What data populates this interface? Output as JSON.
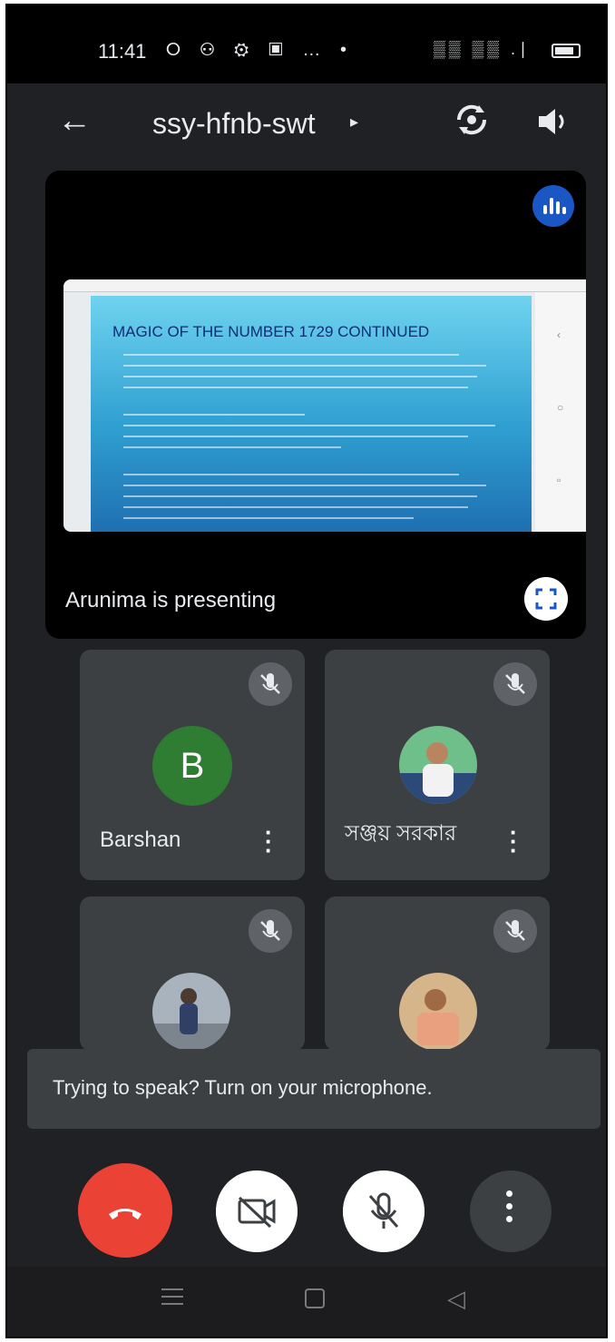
{
  "status_bar": {
    "time": "11:41",
    "left_icons": "⭘ ⚇ ⚙ ▣ … •",
    "right_icons": "▒▒ ▒▒ .∣"
  },
  "header": {
    "meeting_code": "ssy-hfnb-swt",
    "caret": "▸"
  },
  "presentation": {
    "slide_title": "MAGIC OF THE NUMBER 1729 CONTINUED",
    "presenter_label": "Arunima is presenting"
  },
  "participants": [
    {
      "name": "Barshan",
      "initial": "B",
      "avatar_type": "letter",
      "avatar_color": "#2e7d32"
    },
    {
      "name": "সঞ্জয় সরকার",
      "avatar_type": "photo"
    },
    {
      "name": "",
      "avatar_type": "photo"
    },
    {
      "name": "",
      "avatar_type": "photo"
    }
  ],
  "toast": {
    "message": "Trying to speak? Turn on your microphone."
  },
  "colors": {
    "end_call": "#ea4335",
    "background": "#202124",
    "tile": "#3c4043",
    "speaking_indicator": "#1a57c4"
  }
}
